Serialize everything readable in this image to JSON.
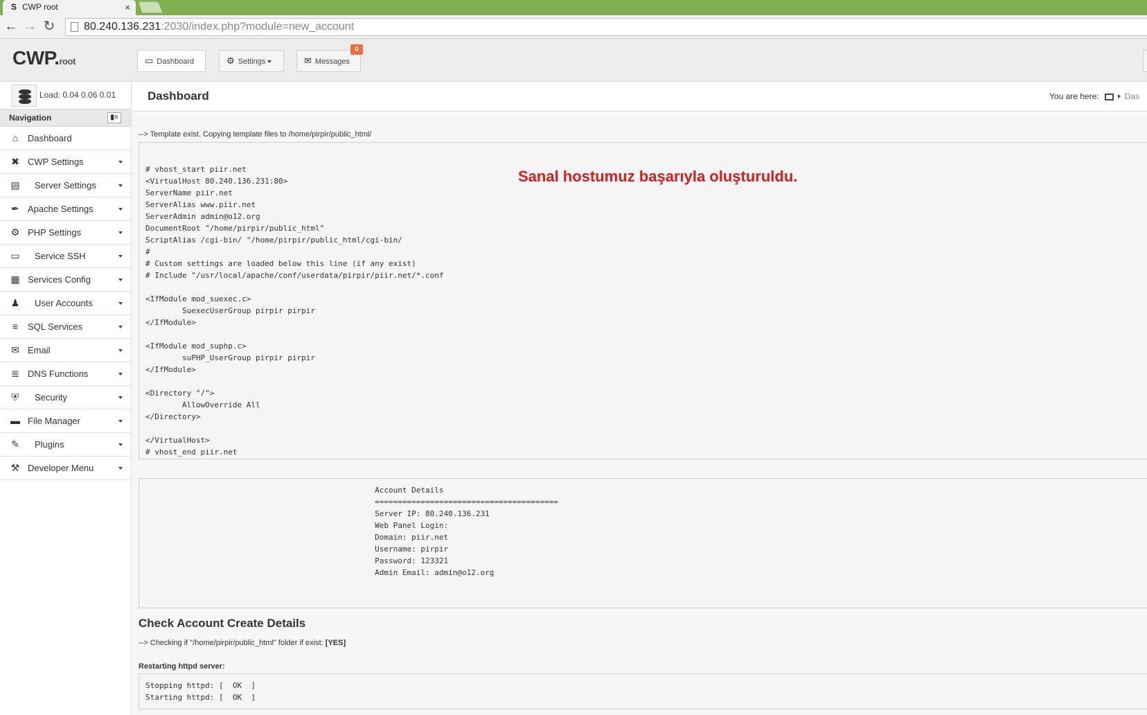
{
  "browser": {
    "tab_favicon": "S",
    "tab_title": "CWP root",
    "tab_close": "×",
    "back": "←",
    "forward": "→",
    "reload": "↻",
    "url_host": "80.240.136.231",
    "url_path": ":2030/index.php?module=new_account"
  },
  "header": {
    "logo": "CWP.",
    "logo_sub": "root",
    "buttons": {
      "dashboard": "Dashboard",
      "settings": "Settings",
      "messages": "Messages",
      "messages_count": "0"
    }
  },
  "sidebar": {
    "load_label": "Load: 0.04  0.06  0.01",
    "nav_title": "Navigation",
    "items": [
      {
        "label": "Dashboard",
        "icon": "home-icon",
        "glyph": "⌂"
      },
      {
        "label": "CWP Settings",
        "icon": "tools-icon",
        "glyph": "✖"
      },
      {
        "label": "Server Settings",
        "icon": "server-icon",
        "glyph": "▤"
      },
      {
        "label": "Apache Settings",
        "icon": "feather-icon",
        "glyph": "✒"
      },
      {
        "label": "PHP Settings",
        "icon": "gear-icon",
        "glyph": "⚙"
      },
      {
        "label": "Service SSH",
        "icon": "monitor-icon",
        "glyph": "▭"
      },
      {
        "label": "Services Config",
        "icon": "config-icon",
        "glyph": "▦"
      },
      {
        "label": "User Accounts",
        "icon": "user-icon",
        "glyph": "♟"
      },
      {
        "label": "SQL Services",
        "icon": "database-icon",
        "glyph": "≡"
      },
      {
        "label": "Email",
        "icon": "envelope-icon",
        "glyph": "✉"
      },
      {
        "label": "DNS Functions",
        "icon": "stack-icon",
        "glyph": "≣"
      },
      {
        "label": "Security",
        "icon": "shield-icon",
        "glyph": "⛨"
      },
      {
        "label": "File Manager",
        "icon": "folder-icon",
        "glyph": "▬"
      },
      {
        "label": "Plugins",
        "icon": "plug-icon",
        "glyph": "✎"
      },
      {
        "label": "Developer Menu",
        "icon": "hammer-icon",
        "glyph": "⚒"
      }
    ]
  },
  "main": {
    "title": "Dashboard",
    "breadcrumb_label": "You are here:",
    "breadcrumb_current": "Das",
    "template_msg": "--> Template exist. Copying template files to /home/pirpir/public_html/",
    "vhost_config": "# vhost_start piir.net\n<VirtualHost 80.240.136.231:80>\nServerName piir.net\nServerAlias www.piir.net\nServerAdmin admin@o12.org\nDocumentRoot \"/home/pirpir/public_html\"\nScriptAlias /cgi-bin/ \"/home/pirpir/public_html/cgi-bin/\n#\n# Custom settings are loaded below this line (if any exist)\n# Include \"/usr/local/apache/conf/userdata/pirpir/piir.net/*.conf\n\n<IfModule mod_suexec.c>\n        SuexecUserGroup pirpir pirpir\n</IfModule>\n\n<IfModule mod_suphp.c>\n        suPHP_UserGroup pirpir pirpir\n</IfModule>\n\n<Directory \"/\">\n        AllowOverride All\n</Directory>\n\n</VirtualHost>\n# vhost_end piir.net",
    "overlay_text": "Sanal hostumuz başarıyla oluşturuldu.",
    "account_details": "                                                  Account Details\n                                                  ========================================\n                                                  Server IP: 80.240.136.231\n                                                  Web Panel Login:\n                                                  Domain: piir.net\n                                                  Username: pirpir\n                                                  Password: 123321\n                                                  Admin Email: admin@o12.org",
    "check_title": "Check Account Create Details",
    "check_msg_prefix": "--> Checking if \"/home/pirpir/public_html\" folder if exist: ",
    "check_msg_result": "[YES]",
    "restart_label": "Restarting httpd server:",
    "restart_output": "Stopping httpd: [  OK  ]\nStarting httpd: [  OK  ]"
  },
  "colors": {
    "browser_tabbar": "#7fb152",
    "badge": "#f26b3a",
    "overlay_text": "#d91b1b"
  }
}
